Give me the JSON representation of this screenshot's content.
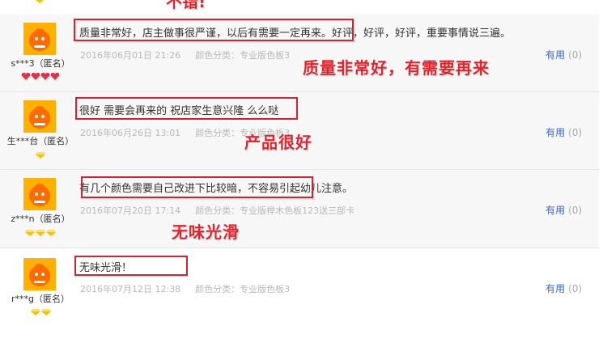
{
  "top_fragment": "不错!",
  "reviews": [
    {
      "user": "s***3（匿名）",
      "level": "hearts",
      "level_count": 4,
      "text": "质量非常好，店主做事很严谨，以后有需要一定再来。好评，好评，好评，重要事情说三遍。",
      "date": "2016年06月01日 21:26",
      "sku": "颜色分类：专业版色板3",
      "helpful_label": "有用",
      "helpful_count": "(0)",
      "annotation": "质量非常好，有需要再来"
    },
    {
      "user": "生***台（匿名）",
      "level": "gems",
      "level_count": 1,
      "text": "很好 需要会再来的 祝店家生意兴隆 么么哒",
      "date": "2016年06月26日 13:01",
      "sku": "颜色分类：专业版色板3",
      "helpful_label": "有用",
      "helpful_count": "(0)",
      "annotation": "产品很好"
    },
    {
      "user": "z***n（匿名）",
      "level": "gems",
      "level_count": 3,
      "text": "有几个颜色需要自己改进下比较暗，不容易引起幼儿注意。",
      "date": "2016年07月20日 17:14",
      "sku": "颜色分类：专业版榉木色板123送三部卡",
      "helpful_label": "有用",
      "helpful_count": "(0)",
      "annotation": "无味光滑"
    },
    {
      "user": "r***g（匿名）",
      "level": "gems",
      "level_count": 2,
      "text": "无味光滑！",
      "date": "2016年07月12日 12:38",
      "sku": "颜色分类：专业版色板3",
      "helpful_label": "有用",
      "helpful_count": "(0)",
      "annotation": ""
    }
  ],
  "colors": {
    "accent_red": "#e8202a",
    "link_blue": "#3366cc",
    "meta_gray": "#b9b9b9",
    "gem_yellow": "#f5c400",
    "heart_red": "#e0334a"
  }
}
